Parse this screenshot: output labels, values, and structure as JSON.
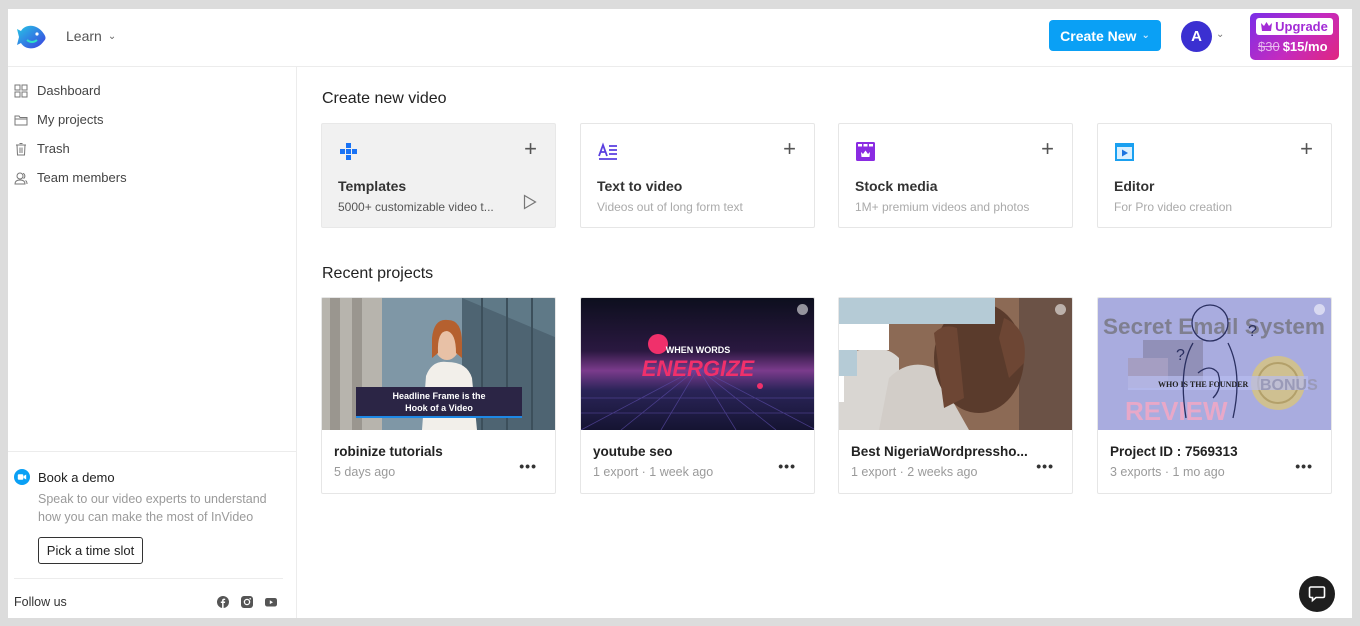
{
  "header": {
    "learn_label": "Learn",
    "create_new_label": "Create New",
    "avatar_initial": "A",
    "upgrade": {
      "label": "Upgrade",
      "old_price": "$30",
      "new_price": "$15/mo"
    }
  },
  "sidebar": {
    "items": [
      {
        "label": "Dashboard",
        "icon": "grid-icon"
      },
      {
        "label": "My projects",
        "icon": "folder-icon"
      },
      {
        "label": "Trash",
        "icon": "trash-icon"
      },
      {
        "label": "Team members",
        "icon": "users-icon"
      }
    ],
    "demo": {
      "title": "Book a demo",
      "description": "Speak to our video experts to understand how you can make the most of InVideo",
      "button_label": "Pick a time slot"
    },
    "follow_label": "Follow us",
    "social": [
      "facebook-icon",
      "instagram-icon",
      "youtube-icon"
    ]
  },
  "main": {
    "create_title": "Create new video",
    "create_cards": [
      {
        "title": "Templates",
        "description": "5000+ customizable video t...",
        "icon": "templates-icon"
      },
      {
        "title": "Text to video",
        "description": "Videos out of long form text",
        "icon": "text-to-video-icon"
      },
      {
        "title": "Stock media",
        "description": "1M+ premium videos and photos",
        "icon": "stock-media-icon"
      },
      {
        "title": "Editor",
        "description": "For Pro video creation",
        "icon": "editor-icon"
      }
    ],
    "recent_title": "Recent projects",
    "projects": [
      {
        "title": "robinize tutorials",
        "meta": "5 days ago",
        "thumb_caption_1": "Headline Frame is the",
        "thumb_caption_2": "Hook of a Video"
      },
      {
        "title": "youtube seo",
        "meta": "1 export · 1 week ago",
        "thumb_caption_1": "WHEN WORDS",
        "thumb_caption_2": "ENERGIZE"
      },
      {
        "title": "Best NigeriaWordpressho...",
        "meta": "1 export · 2 weeks ago"
      },
      {
        "title": "Project ID : 7569313",
        "meta": "3 exports · 1 mo ago",
        "thumb_caption_1": "Secret Email System",
        "thumb_caption_2": "REVIEW",
        "thumb_caption_3": "WHO IS THE FOUNDER",
        "thumb_caption_4": "BONUS"
      }
    ],
    "more_label": "•••"
  },
  "colors": {
    "primary": "#0aa0f5",
    "avatar": "#3b30d1",
    "upgrade_start": "#7a2ee8",
    "upgrade_end": "#e0277f"
  }
}
